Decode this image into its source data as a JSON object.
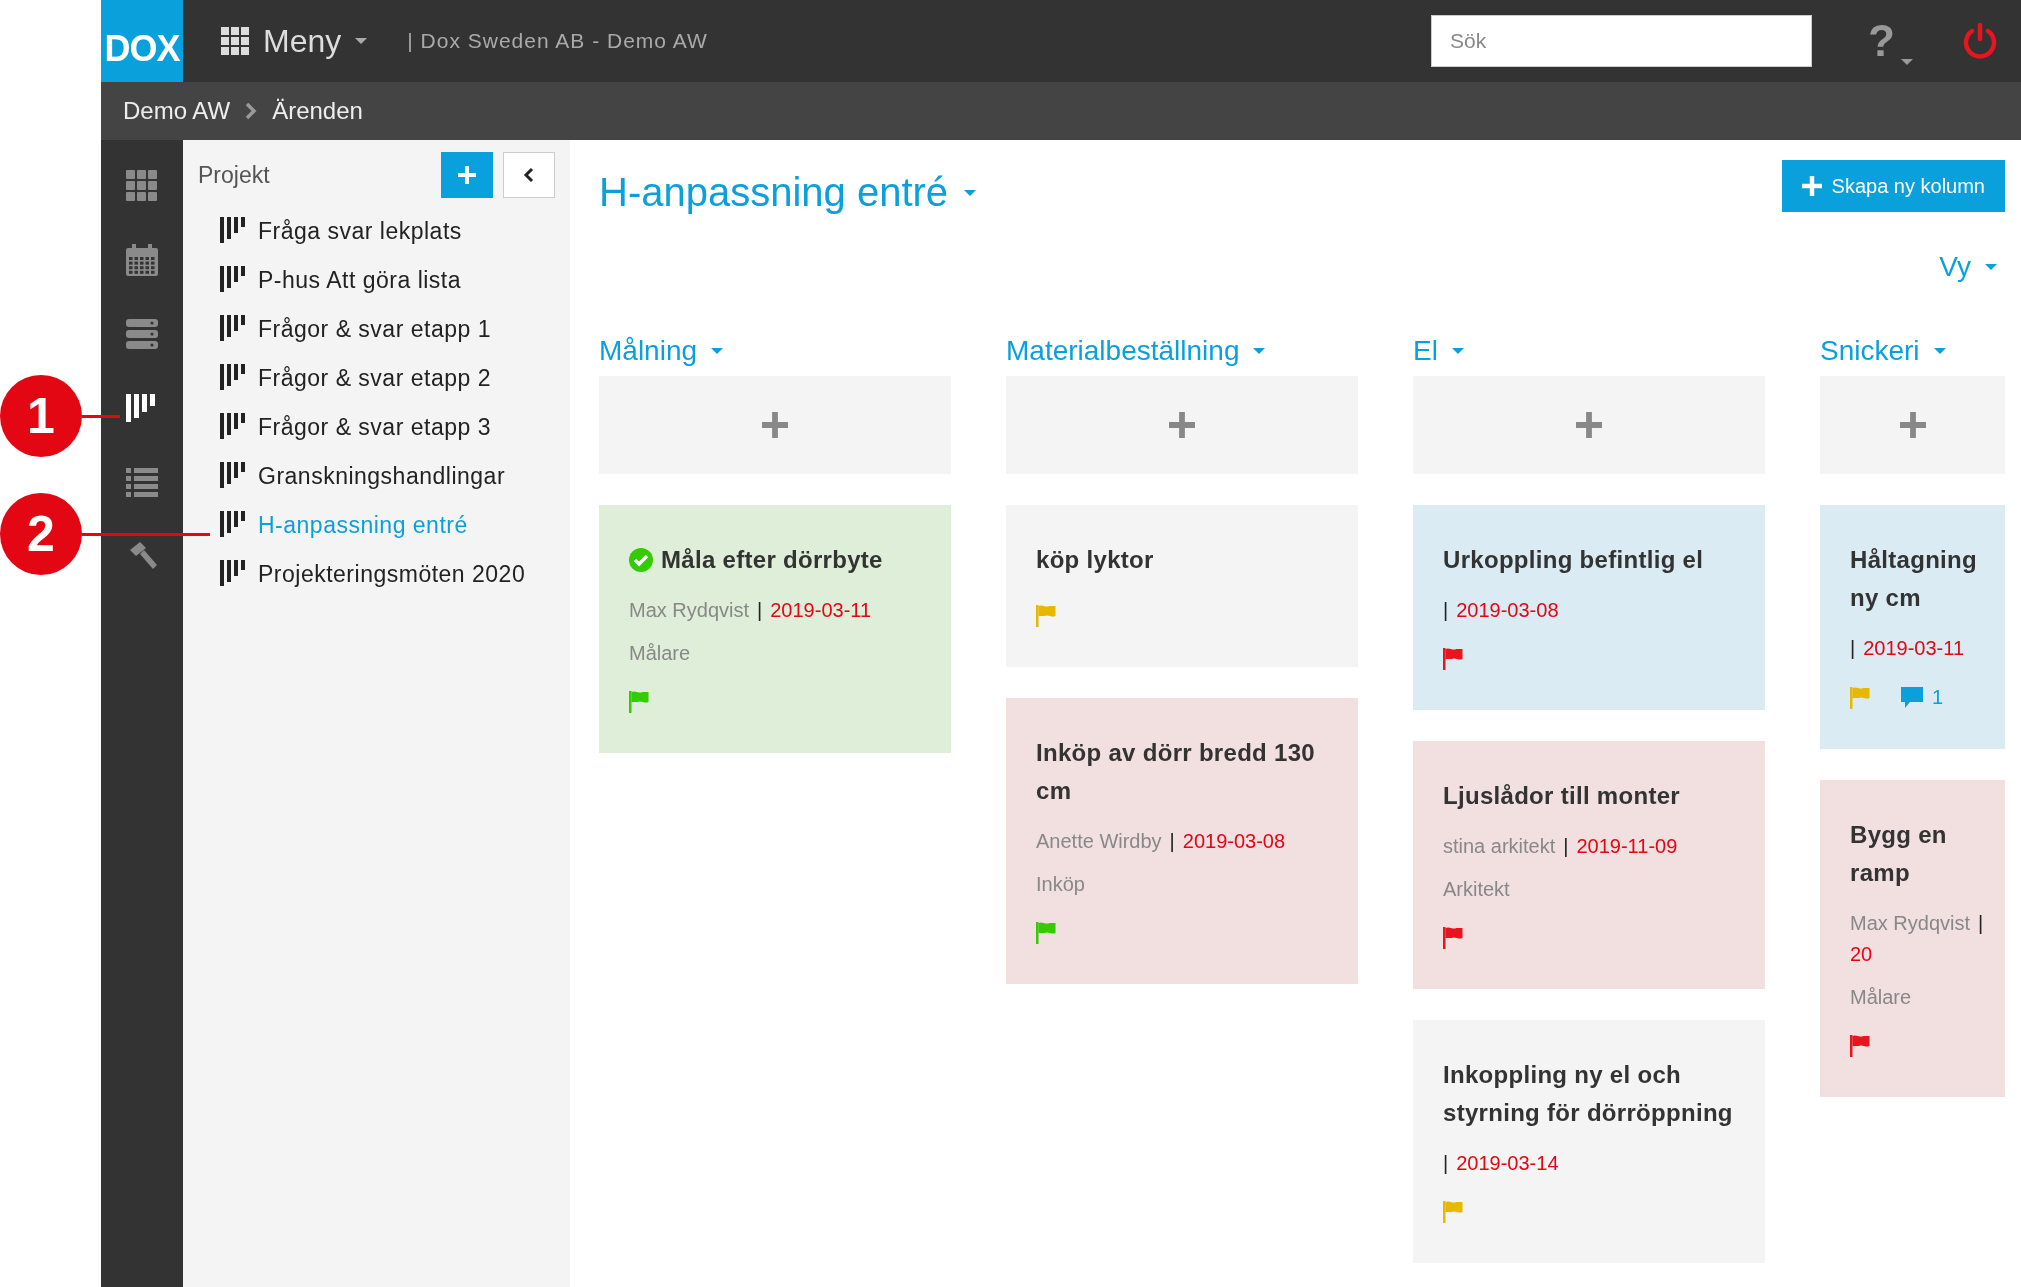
{
  "topbar": {
    "logo": "DOX",
    "menu_label": "Meny",
    "company": "| Dox Sweden AB - Demo AW",
    "search": {
      "placeholder": "Sök"
    },
    "help": "?"
  },
  "breadcrumb": [
    "Demo AW",
    "Ärenden"
  ],
  "rail": [
    {
      "kind": "grid",
      "selected": false
    },
    {
      "kind": "calendar",
      "selected": false
    },
    {
      "kind": "stack",
      "selected": false
    },
    {
      "kind": "board",
      "selected": true
    },
    {
      "kind": "list",
      "selected": false
    },
    {
      "kind": "hammer",
      "selected": false
    }
  ],
  "callouts": [
    "1",
    "2"
  ],
  "projects": {
    "title": "Projekt",
    "items": [
      {
        "label": "Fråga svar lekplats",
        "selected": false
      },
      {
        "label": "P-hus Att göra lista",
        "selected": false
      },
      {
        "label": "Frågor & svar etapp 1",
        "selected": false
      },
      {
        "label": "Frågor & svar etapp 2",
        "selected": false
      },
      {
        "label": "Frågor & svar etapp 3",
        "selected": false
      },
      {
        "label": "Granskningshandlingar",
        "selected": false
      },
      {
        "label": "H-anpassning entré",
        "selected": true
      },
      {
        "label": "Projekteringsmöten 2020",
        "selected": false
      }
    ]
  },
  "board": {
    "title": "H-anpassning entré",
    "create_button": "Skapa ny kolumn",
    "view": "Vy",
    "columns": [
      {
        "title": "Målning",
        "cards": [
          {
            "title": "Måla efter dörrbyte",
            "done": true,
            "assignee": "Max Rydqvist",
            "separator": "|",
            "date": "2019-03-11",
            "role": "Målare",
            "flag": {
              "color": "#33cc00"
            },
            "color": "#dfeed8"
          }
        ]
      },
      {
        "title": "Materialbeställning",
        "cards": [
          {
            "title": "köp lyktor",
            "done": false,
            "flag": {
              "color": "#e6b800"
            },
            "color": "#f4f4f4"
          },
          {
            "title": "Inköp av dörr bredd 130 cm",
            "done": false,
            "assignee": "Anette Wirdby",
            "separator": "|",
            "date": "2019-03-08",
            "role": "Inköp",
            "flag": {
              "color": "#33cc00"
            },
            "color": "#f2dfe0"
          }
        ]
      },
      {
        "title": "El",
        "cards": [
          {
            "title": "Urkoppling befintlig el",
            "done": false,
            "separator": "|",
            "date": "2019-03-08",
            "flag": {
              "color": "#e8141e"
            },
            "color": "#daebf4"
          },
          {
            "title": "Ljuslådor till monter",
            "done": false,
            "assignee": "stina arkitekt",
            "separator": "|",
            "date": "2019-11-09",
            "role": "Arkitekt",
            "flag": {
              "color": "#e8141e"
            },
            "color": "#f2dfe0"
          },
          {
            "title": "Inkoppling ny el och styrning för dörröppning",
            "done": false,
            "separator": "|",
            "date": "2019-03-14",
            "flag": {
              "color": "#e6b800"
            },
            "color": "#f4f4f4"
          }
        ]
      },
      {
        "title": "Snickeri",
        "cards": [
          {
            "title": "Håltagning ny cm",
            "done": false,
            "separator": "|",
            "date": "2019-03-11",
            "flag": {
              "color": "#e6b800"
            },
            "comments": "1",
            "color": "#daebf4"
          },
          {
            "title": "Bygg en ramp",
            "done": false,
            "assignee": "Max Rydqvist",
            "separator": "|",
            "date": "20",
            "role": "Målare",
            "flag": {
              "color": "#e8141e"
            },
            "color": "#f2dfe0"
          }
        ]
      }
    ]
  }
}
